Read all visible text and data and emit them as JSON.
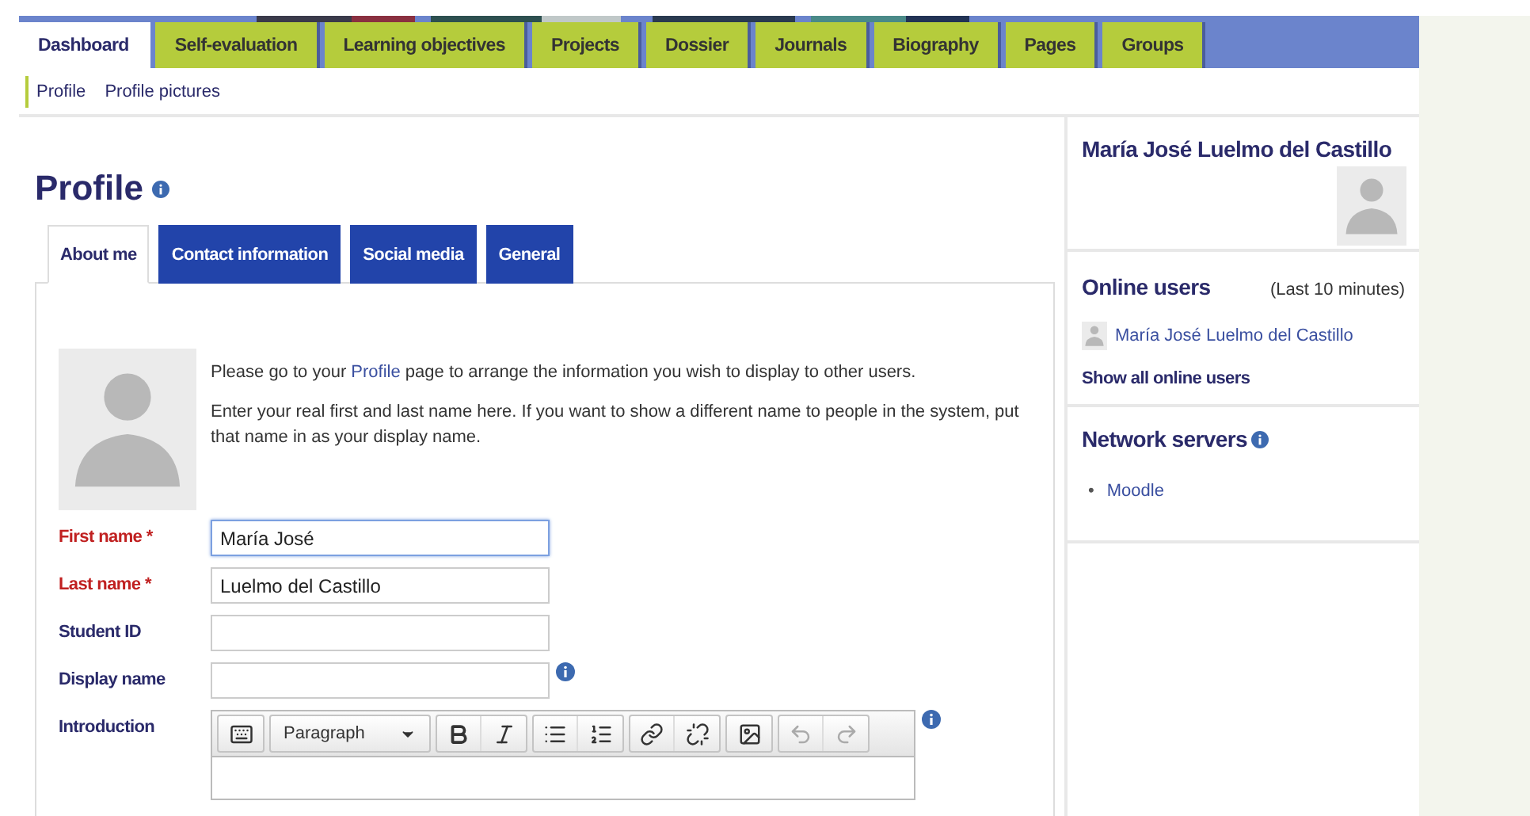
{
  "nav_tabs": [
    {
      "label": "Dashboard",
      "selected": true
    },
    {
      "label": "Self-evaluation",
      "selected": false
    },
    {
      "label": "Learning objectives",
      "selected": false
    },
    {
      "label": "Projects",
      "selected": false
    },
    {
      "label": "Dossier",
      "selected": false
    },
    {
      "label": "Journals",
      "selected": false
    },
    {
      "label": "Biography",
      "selected": false
    },
    {
      "label": "Pages",
      "selected": false
    },
    {
      "label": "Groups",
      "selected": false
    }
  ],
  "subnav": [
    {
      "label": "Profile",
      "selected": true
    },
    {
      "label": "Profile pictures",
      "selected": false
    }
  ],
  "page_title": "Profile",
  "form_tabs": [
    {
      "label": "About me",
      "selected": true
    },
    {
      "label": "Contact information",
      "selected": false
    },
    {
      "label": "Social media",
      "selected": false
    },
    {
      "label": "General",
      "selected": false
    }
  ],
  "intro": {
    "before": "Please go to your ",
    "link": "Profile",
    "after": " page to arrange the information you wish to display to other users."
  },
  "hint": "Enter your real first and last name here. If you want to show a different name to people in the system, put that name in as your display name.",
  "fields": [
    {
      "kind": "input",
      "label": "First name *",
      "required": true,
      "value": "María José",
      "focused": true,
      "info": false
    },
    {
      "kind": "input",
      "label": "Last name *",
      "required": true,
      "value": "Luelmo del Castillo",
      "focused": false,
      "info": false
    },
    {
      "kind": "input",
      "label": "Student ID",
      "required": false,
      "focused": false,
      "info": false
    },
    {
      "kind": "input",
      "label": "Display name",
      "required": false,
      "focused": false,
      "info": true
    },
    {
      "kind": "editor",
      "label": "Introduction",
      "required": false,
      "format": "Paragraph",
      "info": true
    }
  ],
  "profile_block": {
    "name": "María José Luelmo del Castillo"
  },
  "online_users": {
    "title": "Online users",
    "period": "(Last 10 minutes)",
    "users": [
      "María José Luelmo del Castillo"
    ],
    "show_all": "Show all online users"
  },
  "network_servers": {
    "title": "Network servers",
    "items": [
      {
        "marker": "•",
        "label": "Moodle"
      }
    ]
  }
}
